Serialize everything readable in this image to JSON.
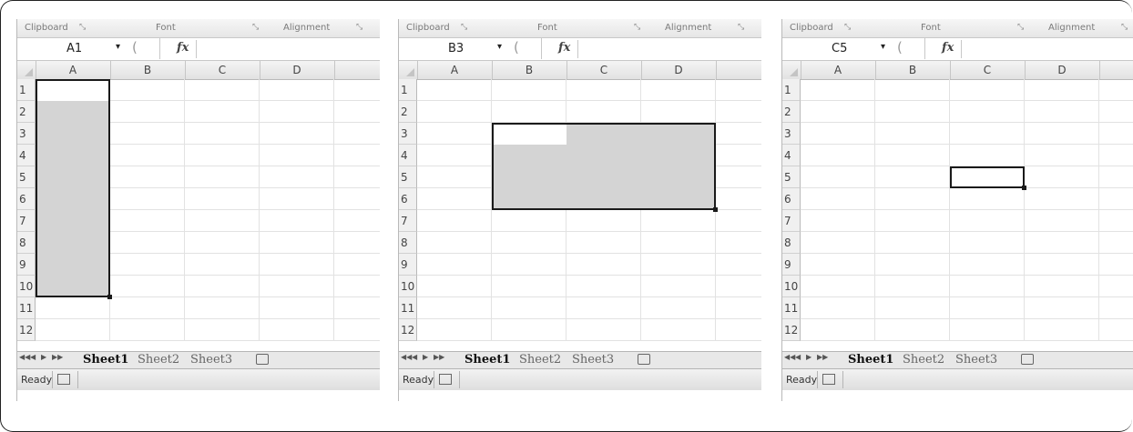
{
  "ribbon": {
    "clipboard": "Clipboard",
    "font": "Font",
    "alignment": "Alignment",
    "launcher_glyph": "⤡"
  },
  "formula_bar": {
    "dropdown_arrow": "▾",
    "paren": "(",
    "fx_label": "fx"
  },
  "columns": [
    "A",
    "B",
    "C",
    "D"
  ],
  "rows": [
    "1",
    "2",
    "3",
    "4",
    "5",
    "6",
    "7",
    "8",
    "9",
    "10",
    "11",
    "12"
  ],
  "sheet_tabs": [
    "Sheet1",
    "Sheet2",
    "Sheet3"
  ],
  "nav_buttons": [
    "◀◀",
    "◀",
    "▶",
    "▶▶"
  ],
  "status_text": "Ready",
  "panels": [
    {
      "name_box": "A1",
      "selection": "A1:A10",
      "active_cell": "A1"
    },
    {
      "name_box": "B3",
      "selection": "B3:D6",
      "active_cell": "B3"
    },
    {
      "name_box": "C5",
      "selection": "C5",
      "active_cell": "C5"
    }
  ],
  "colors": {
    "selection_fill": "#d4d4d4",
    "selection_border": "#1a1a1a"
  }
}
